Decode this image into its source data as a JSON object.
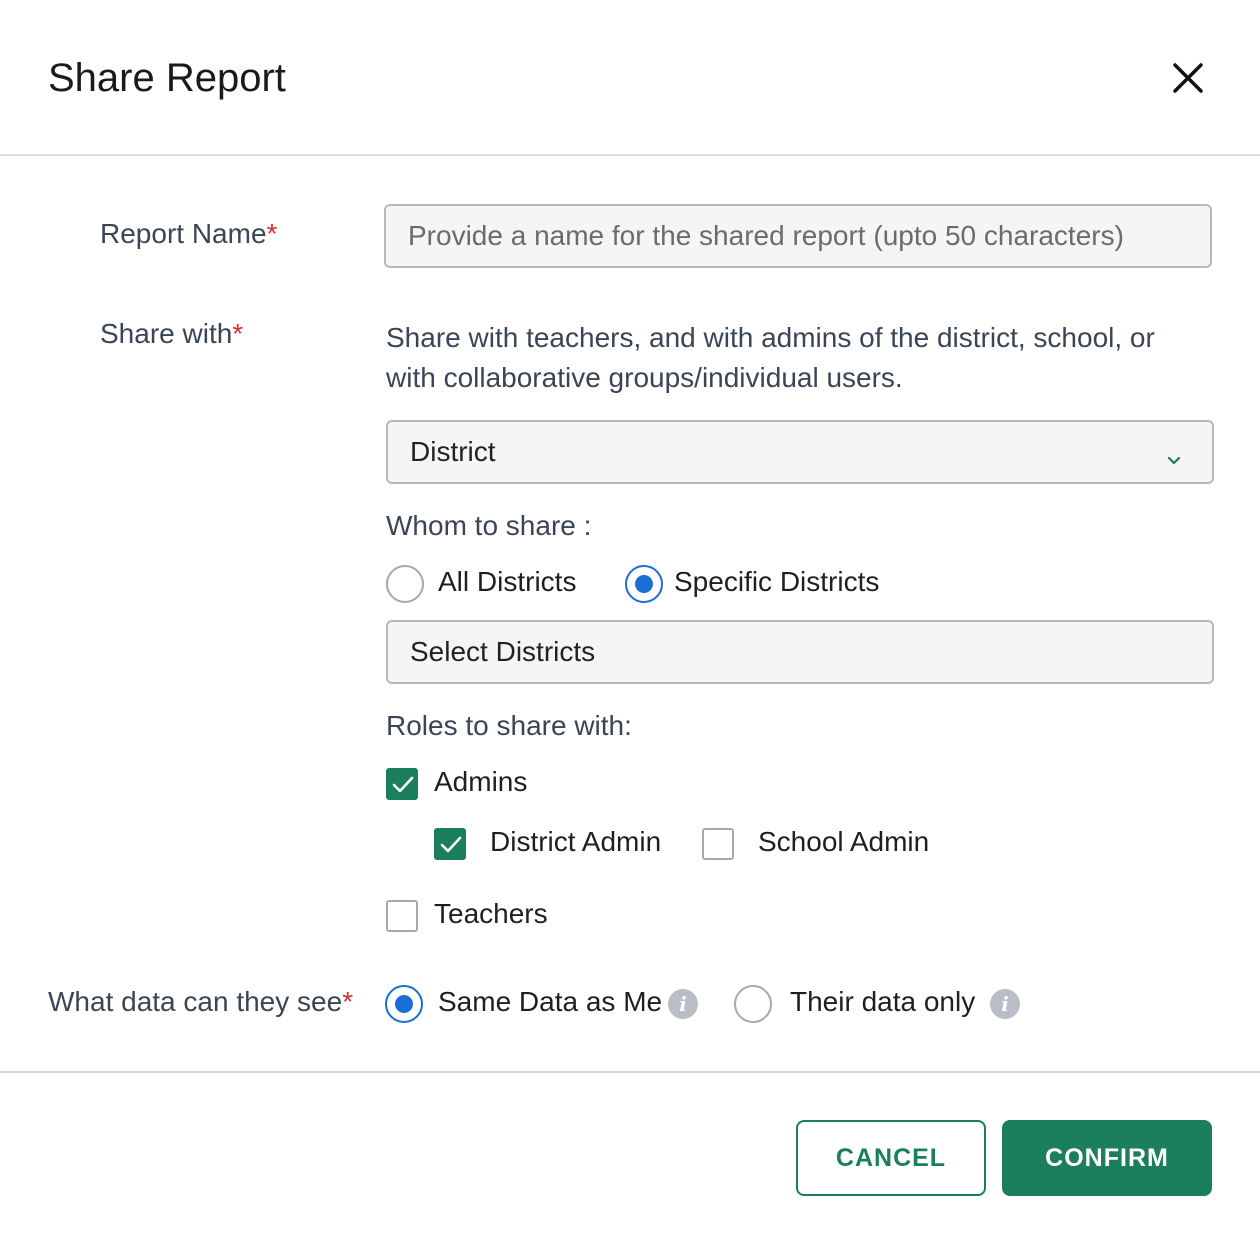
{
  "dialog": {
    "title": "Share Report"
  },
  "report_name": {
    "label": "Report Name",
    "required_mark": "*",
    "placeholder": "Provide a name for the shared report (upto 50 characters)",
    "value": ""
  },
  "share_with": {
    "label": "Share with",
    "required_mark": "*",
    "description": "Share with teachers, and with admins of the district, school, or with collaborative groups/individual users.",
    "selected_level": "District"
  },
  "whom": {
    "label": "Whom to share :",
    "options": [
      {
        "label": "All Districts",
        "selected": false
      },
      {
        "label": "Specific Districts",
        "selected": true
      }
    ],
    "district_select_placeholder": "Select Districts"
  },
  "roles": {
    "label": "Roles to share with:",
    "admins": {
      "label": "Admins",
      "checked": true
    },
    "district_admin": {
      "label": "District Admin",
      "checked": true
    },
    "school_admin": {
      "label": "School Admin",
      "checked": false
    },
    "teachers": {
      "label": "Teachers",
      "checked": false
    }
  },
  "data_visibility": {
    "label": "What data can they see",
    "required_mark": "*",
    "options": [
      {
        "label": "Same Data as Me",
        "selected": true
      },
      {
        "label": "Their data only",
        "selected": false
      }
    ]
  },
  "footer": {
    "cancel_label": "CANCEL",
    "confirm_label": "CONFIRM"
  },
  "colors": {
    "accent_green": "#1a7f5a",
    "radio_blue": "#1b6fd4",
    "required_red": "#d62f2f"
  },
  "icons": {
    "close": "close-icon",
    "dropdown": "chevron-down-icon",
    "check": "check-icon",
    "info": "info-icon"
  }
}
